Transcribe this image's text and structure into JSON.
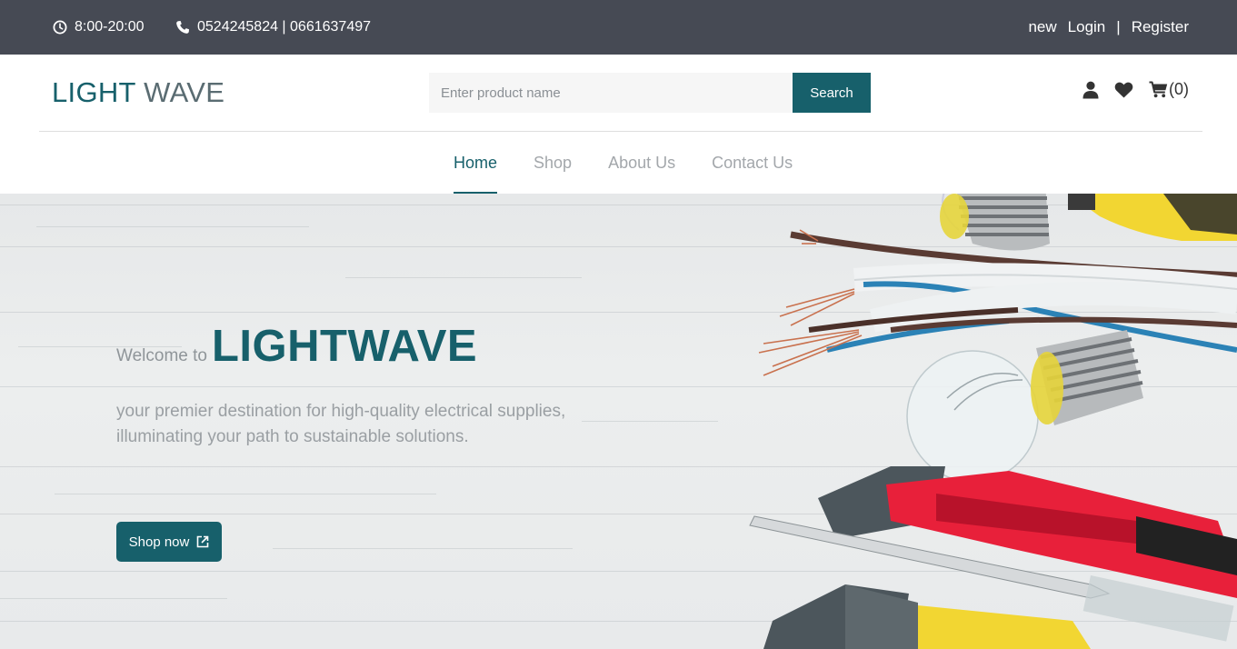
{
  "topbar": {
    "hours": "8:00-20:00",
    "phone": "0524245824 | 0661637497",
    "new_label": "new",
    "login_label": "Login",
    "separator": "|",
    "register_label": "Register",
    "bg_color": "#464a54"
  },
  "header": {
    "logo_part1": "LIGHT",
    "logo_part2": "WAVE",
    "search": {
      "placeholder": "Enter product name",
      "value": "",
      "button_label": "Search"
    },
    "icons": [
      "user-icon",
      "heart-icon",
      "cart-icon"
    ],
    "cart_count": "(0)"
  },
  "nav": {
    "items": [
      {
        "label": "Home",
        "active": true
      },
      {
        "label": "Shop",
        "active": false
      },
      {
        "label": "About Us",
        "active": false
      },
      {
        "label": "Contact Us",
        "active": false
      }
    ]
  },
  "hero": {
    "welcome_prefix": "Welcome to",
    "brand": "LIGHTWAVE",
    "description": "your premier destination for high-quality electrical supplies, illuminating your path to sustainable solutions.",
    "cta_label": "Shop now"
  },
  "colors": {
    "accent": "#17606b",
    "muted_text": "#9a9fa3"
  }
}
